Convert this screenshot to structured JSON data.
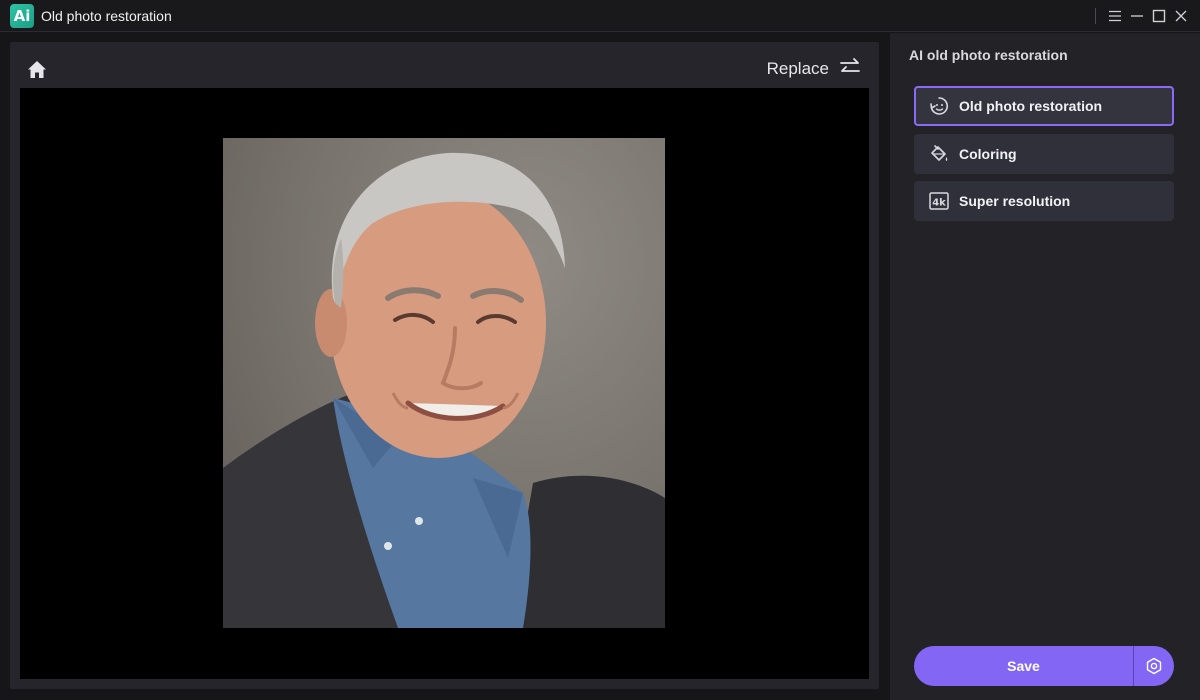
{
  "app": {
    "logo_text": "Ai",
    "title": "Old photo restoration"
  },
  "window_controls": {
    "icons": [
      "menu-icon",
      "minimize-icon",
      "maximize-icon",
      "close-icon"
    ]
  },
  "editor": {
    "home_icon": "home-icon",
    "replace_label": "Replace",
    "replace_icon": "swap-arrows-icon"
  },
  "sidebar": {
    "title": "AI old photo restoration",
    "options": [
      {
        "label": "Old photo restoration",
        "icon": "restore-face-icon",
        "active": true
      },
      {
        "label": "Coloring",
        "icon": "paint-bucket-icon",
        "active": false
      },
      {
        "label": "Super resolution",
        "icon": "4k-icon",
        "active": false
      }
    ],
    "save_label": "Save",
    "settings_icon": "hexagon-settings-icon"
  },
  "colors": {
    "accent": "#8466f5",
    "panel": "#25252b",
    "sidebar": "#222227",
    "canvas": "#000000"
  }
}
